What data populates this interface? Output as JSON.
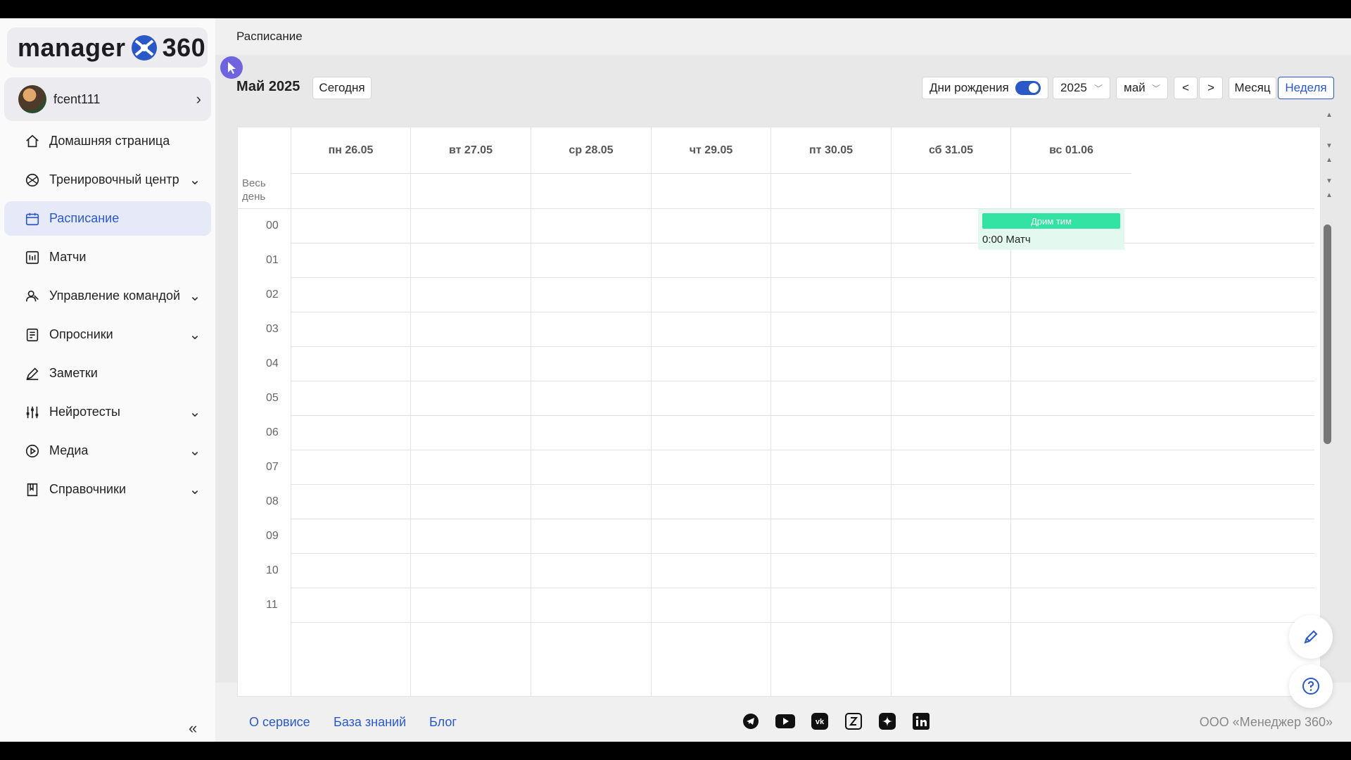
{
  "brand": {
    "logo_text": "manager",
    "logo_num": "360"
  },
  "user": {
    "name": "fcent111"
  },
  "nav": [
    {
      "label": "Домашняя страница",
      "icon": "home-icon",
      "chevron": false,
      "active": false
    },
    {
      "label": "Тренировочный центр",
      "icon": "ball-icon",
      "chevron": true,
      "active": false
    },
    {
      "label": "Расписание",
      "icon": "calendar-icon",
      "chevron": false,
      "active": true
    },
    {
      "label": "Матчи",
      "icon": "scoreboard-icon",
      "chevron": false,
      "active": false
    },
    {
      "label": "Управление командой",
      "icon": "team-icon",
      "chevron": true,
      "active": false
    },
    {
      "label": "Опросники",
      "icon": "survey-icon",
      "chevron": true,
      "active": false
    },
    {
      "label": "Заметки",
      "icon": "pen-icon",
      "chevron": false,
      "active": false
    },
    {
      "label": "Нейротесты",
      "icon": "sliders-icon",
      "chevron": true,
      "active": false
    },
    {
      "label": "Медиа",
      "icon": "play-icon",
      "chevron": true,
      "active": false
    },
    {
      "label": "Справочники",
      "icon": "book-icon",
      "chevron": true,
      "active": false
    }
  ],
  "page": {
    "breadcrumb": "Расписание"
  },
  "toolbar": {
    "title": "Май 2025",
    "today": "Сегодня",
    "birthdays": "Дни рождения",
    "birthdays_on": true,
    "year": "2025",
    "month": "май",
    "prev": "<",
    "next": ">",
    "view_month": "Месяц",
    "view_week": "Неделя",
    "active_view": "Неделя"
  },
  "calendar": {
    "days": [
      "пн 26.05",
      "вт 27.05",
      "ср 28.05",
      "чт 29.05",
      "пт 30.05",
      "сб 31.05",
      "вс 01.06"
    ],
    "allday_label": "Весь день",
    "hours": [
      "00",
      "01",
      "02",
      "03",
      "04",
      "05",
      "06",
      "07",
      "08",
      "09",
      "10",
      "11"
    ],
    "event": {
      "team": "Дрим тим",
      "text": "0:00 Матч",
      "day": "сб 31.05",
      "hour": "00"
    }
  },
  "footer": {
    "links": [
      "О сервисе",
      "База знаний",
      "Блог"
    ],
    "social": [
      "telegram-icon",
      "youtube-icon",
      "vk-icon",
      "yandex-zen-icon",
      "dzen-star-icon",
      "linkedin-icon"
    ],
    "copyright": "ООО «Менеджер 360»"
  },
  "colors": {
    "accent": "#2a59c7",
    "event": "#32e3a3",
    "event_bg": "#e3f8ee",
    "cursor": "#6f63e0"
  }
}
